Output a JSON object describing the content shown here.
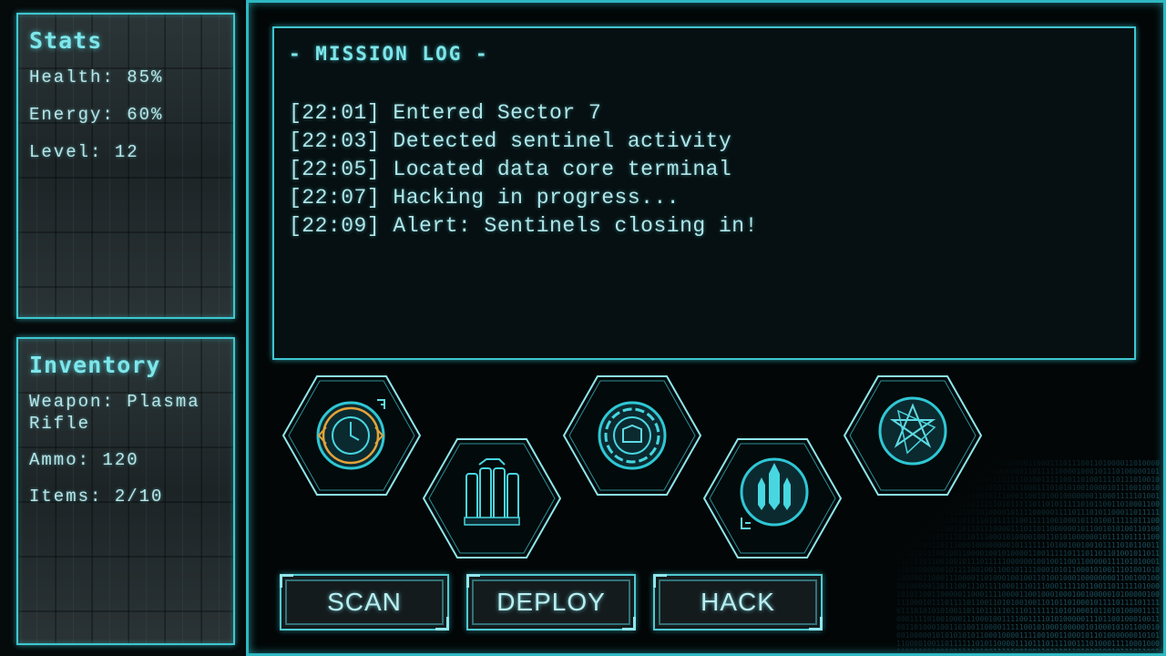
{
  "stats": {
    "title": "Stats",
    "health": "Health: 85%",
    "energy": "Energy: 60%",
    "level": "Level: 12"
  },
  "inventory": {
    "title": "Inventory",
    "weapon": "Weapon: Plasma Rifle",
    "ammo": "Ammo: 120",
    "items": "Items: 2/10"
  },
  "mission_log": {
    "title": "- MISSION LOG -",
    "entries": [
      "[22:01] Entered Sector 7",
      "[22:03] Detected sentinel activity",
      "[22:05] Located data core terminal",
      "[22:07] Hacking in progress...",
      "[22:09] Alert: Sentinels closing in!"
    ]
  },
  "abilities": [
    {
      "icon": "timer-shield-icon",
      "accent": "#e3a33a"
    },
    {
      "icon": "battery-cells-icon"
    },
    {
      "icon": "shield-module-icon"
    },
    {
      "icon": "missile-barrage-icon"
    },
    {
      "icon": "star-rune-icon"
    }
  ],
  "actions": {
    "scan": "SCAN",
    "deploy": "DEPLOY",
    "hack": "HACK"
  },
  "colors": {
    "accent": "#3ec6cf",
    "text": "#aee7ea",
    "background": "#020607",
    "highlight": "#e3a33a"
  }
}
